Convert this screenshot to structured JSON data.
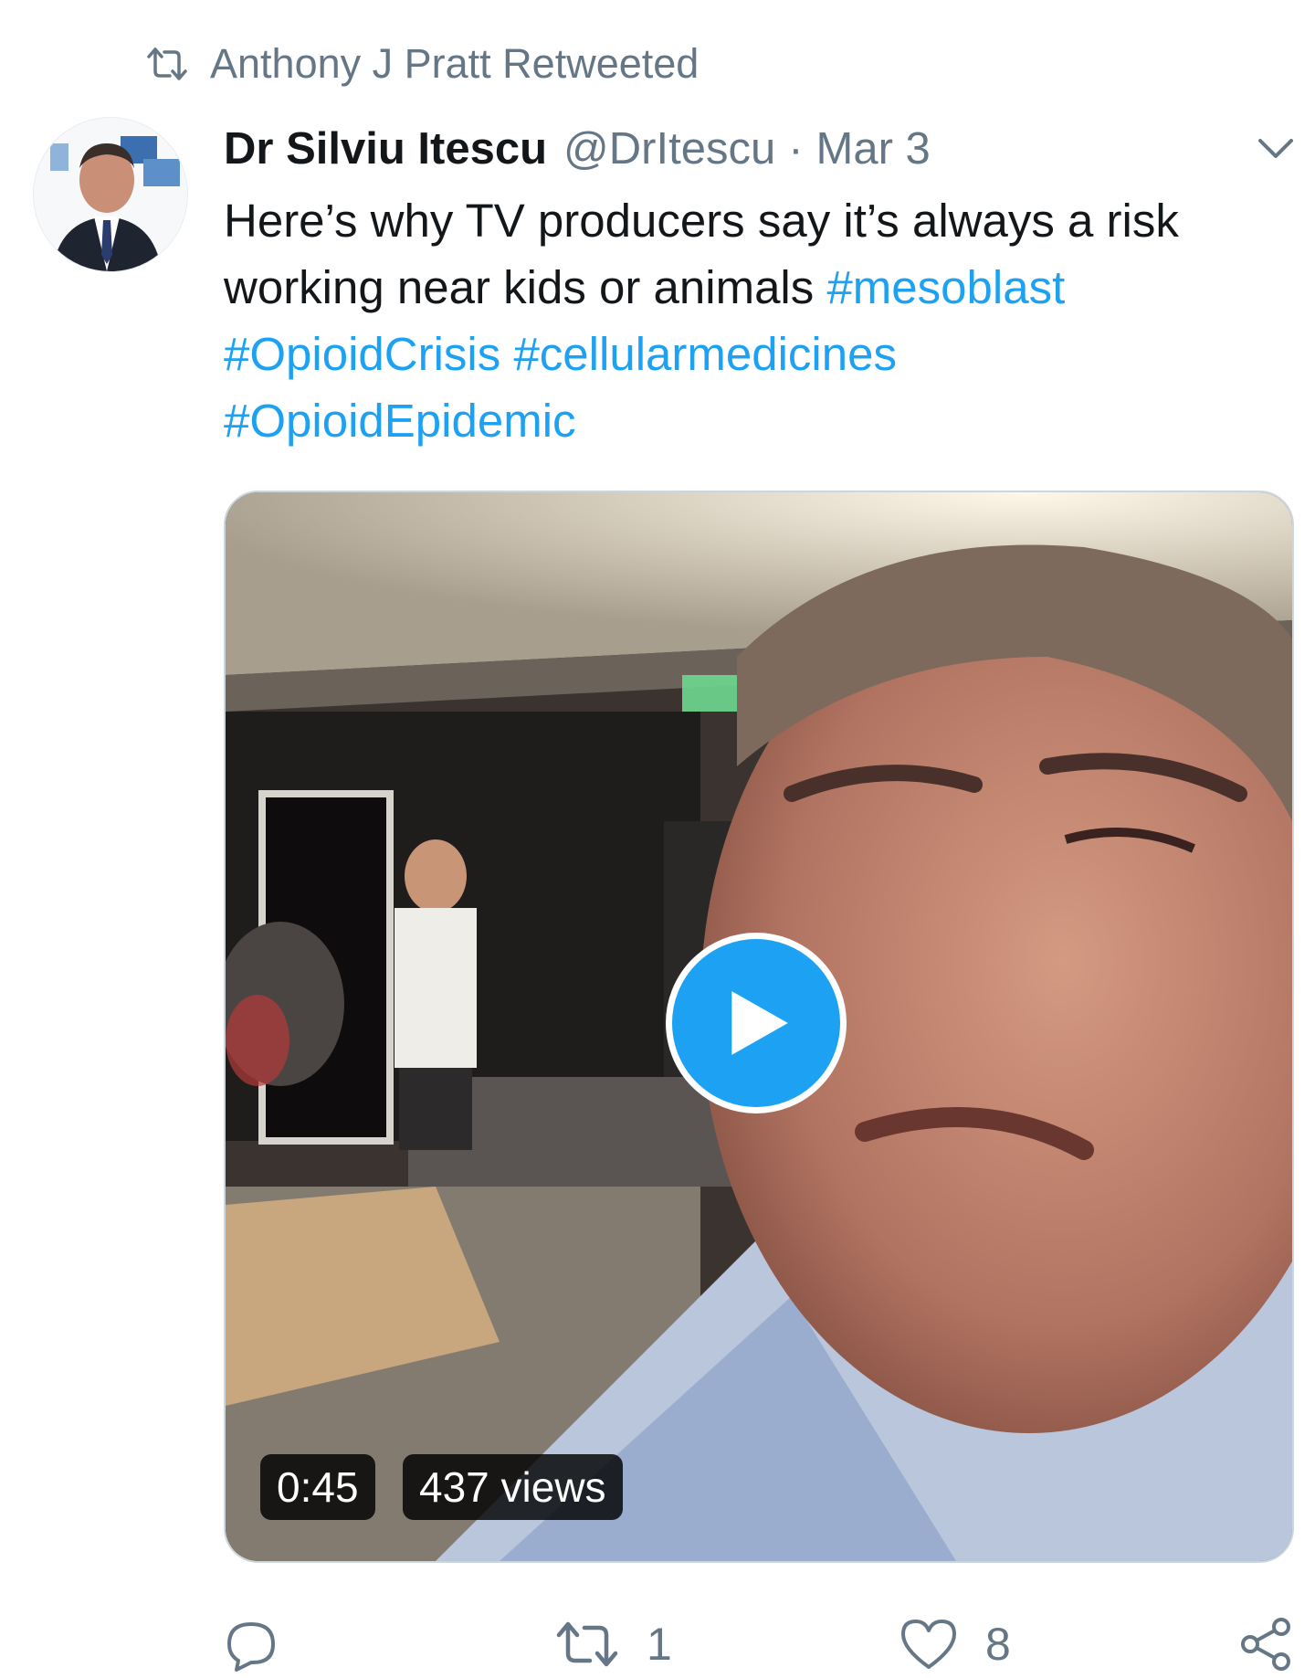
{
  "retweet_context": {
    "text": "Anthony J Pratt Retweeted",
    "icon": "retweet-icon"
  },
  "tweet": {
    "author_name": "Dr Silviu Itescu",
    "author_handle": "@DrItescu",
    "separator": "·",
    "date": "Mar 3",
    "text_line1": "Here’s why TV producers say it’s always a risk",
    "text_line2": "working near kids or animals ",
    "hashtags": {
      "h1": "#mesoblast",
      "h2": "#OpioidCrisis",
      "h3": "#cellularmedicines",
      "h4": "#OpioidEpidemic"
    },
    "media": {
      "type": "video",
      "duration": "0:45",
      "views": "437 views",
      "play_icon": "play-icon"
    },
    "actions": {
      "reply_icon": "reply-icon",
      "retweet_icon": "retweet-icon",
      "retweet_count": "1",
      "like_icon": "heart-icon",
      "like_count": "8",
      "share_icon": "share-icon"
    }
  },
  "colors": {
    "link": "#1da1f2",
    "muted": "#657786",
    "text": "#14171a",
    "play_button": "#1da1f2"
  }
}
